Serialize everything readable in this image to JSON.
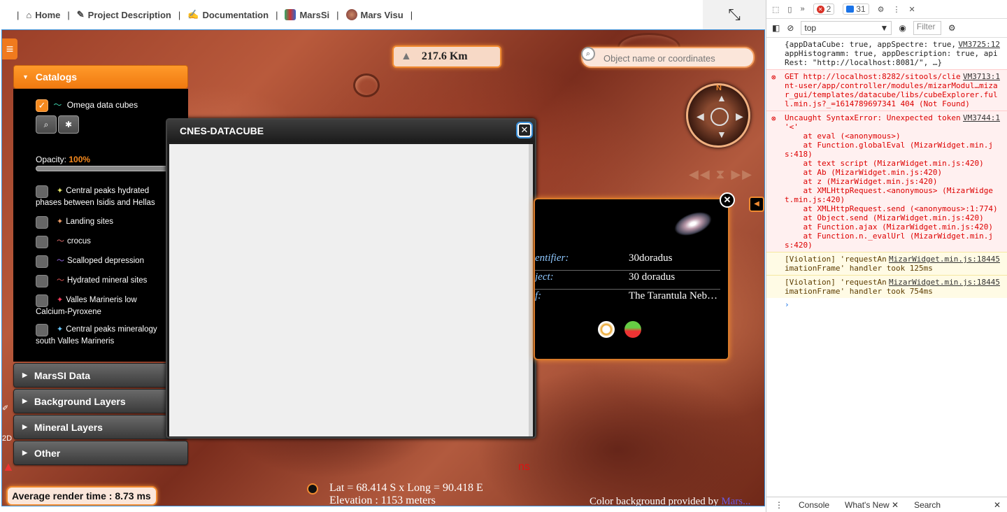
{
  "nav": {
    "items": [
      {
        "label": "Home"
      },
      {
        "label": "Project Description"
      },
      {
        "label": "Documentation"
      },
      {
        "label": "MarsSi"
      },
      {
        "label": "Mars Visu"
      }
    ]
  },
  "catalogs": {
    "title": "Catalogs",
    "cube": {
      "label": "Omega data cubes",
      "opacity_label": "Opacity:",
      "opacity_value": "100%"
    },
    "layers": [
      {
        "line1": "Central peaks hydrated",
        "line2": "phases between Isidis and Hellas",
        "glyph": "✦",
        "color": "#e8e86a"
      },
      {
        "line1": "Landing sites",
        "line2": "",
        "glyph": "✦",
        "color": "#f3a06a"
      },
      {
        "line1": "crocus",
        "line2": "",
        "glyph": "〜",
        "color": "#e87070"
      },
      {
        "line1": "Scalloped depression",
        "line2": "",
        "glyph": "〜",
        "color": "#9a6ae8"
      },
      {
        "line1": "Hydrated mineral sites",
        "line2": "",
        "glyph": "〜",
        "color": "#e85a5a"
      },
      {
        "line1": "Valles Marineris low",
        "line2": "Calcium-Pyroxene",
        "glyph": "✦",
        "color": "#ff4060"
      },
      {
        "line1": "Central peaks mineralogy",
        "line2": "south Valles Marineris",
        "glyph": "✦",
        "color": "#6ac8ff"
      }
    ]
  },
  "sections": [
    {
      "label": "MarsSI Data"
    },
    {
      "label": "Background Layers"
    },
    {
      "label": "Mineral Layers"
    },
    {
      "label": "Other"
    }
  ],
  "datacube": {
    "title": "CNES-DATACUBE"
  },
  "distance": "217.6 Km",
  "search": {
    "placeholder": "Object name or coordinates"
  },
  "info": {
    "rows": [
      {
        "k": "entifier:",
        "v": "30doradus"
      },
      {
        "k": "ject:",
        "v": "30 doradus"
      },
      {
        "k": "f:",
        "v": "The Tarantula Neb…"
      }
    ]
  },
  "render": "Average render time : 8.73 ms",
  "coords": {
    "line1": "Lat = 68.414 S x Long = 90.418 E",
    "line2": "Elevation : 1153 meters"
  },
  "credit": {
    "text": "Color background provided by ",
    "link": "Mars..."
  },
  "ns": "ns",
  "devtools": {
    "errors": "2",
    "messages": "31",
    "context": "top",
    "filter": "Filter",
    "logs": [
      {
        "type": "info",
        "src": "VM3725:12",
        "text": "{appDataCube: true, appSpectre: true, appHistogramm: true, appDescription: true, apiRest: \"http://localhost:8081/\", …}"
      },
      {
        "type": "err",
        "src": "VM3713:1",
        "text": "GET http://localhost:8282/sitools/client-user/app/controller/modules/mizarModul…mizar_gui/templates/datacube/libs/cubeExplorer.full.min.js?_=1614789697341 404 (Not Found)"
      },
      {
        "type": "err",
        "src": "VM3744:1",
        "text": "Uncaught SyntaxError: Unexpected token '<'\n    at eval (<anonymous>)\n    at Function.globalEval (MizarWidget.min.js:418)\n    at text script (MizarWidget.min.js:420)\n    at Ab (MizarWidget.min.js:420)\n    at z (MizarWidget.min.js:420)\n    at XMLHttpRequest.<anonymous> (MizarWidget.min.js:420)\n    at XMLHttpRequest.send (<anonymous>:1:774)\n    at Object.send (MizarWidget.min.js:420)\n    at Function.ajax (MizarWidget.min.js:420)\n    at Function.n._evalUrl (MizarWidget.min.js:420)"
      },
      {
        "type": "warn",
        "src": "MizarWidget.min.js:18445",
        "text": "[Violation] 'requestAnimationFrame' handler took 125ms"
      },
      {
        "type": "warn",
        "src": "MizarWidget.min.js:18445",
        "text": "[Violation] 'requestAnimationFrame' handler took 754ms"
      }
    ],
    "tabs": [
      {
        "label": "Console"
      },
      {
        "label": "What's New"
      },
      {
        "label": "Search"
      }
    ]
  }
}
